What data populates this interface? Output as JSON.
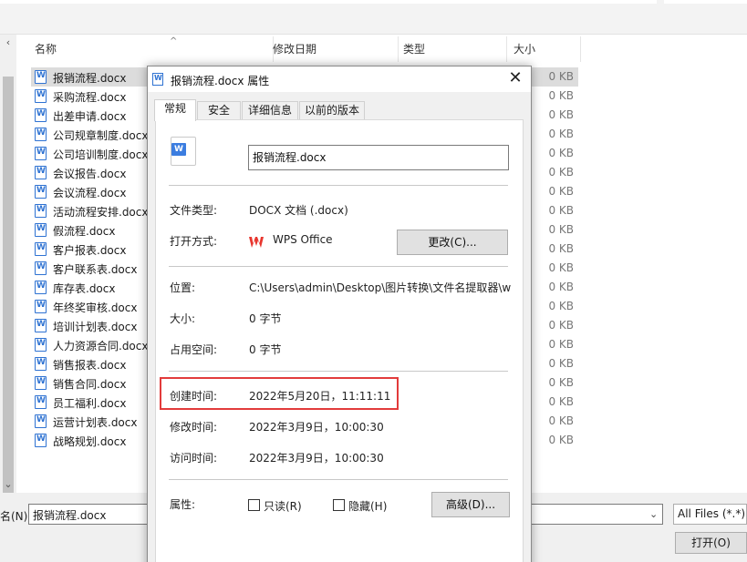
{
  "columns": {
    "name": "名称",
    "modified": "修改日期",
    "type": "类型",
    "size": "大小"
  },
  "files": [
    {
      "name": "报销流程.docx",
      "size": "0 KB"
    },
    {
      "name": "采购流程.docx",
      "size": "0 KB"
    },
    {
      "name": "出差申请.docx",
      "size": "0 KB"
    },
    {
      "name": "公司规章制度.docx",
      "size": "0 KB"
    },
    {
      "name": "公司培训制度.docx",
      "size": "0 KB"
    },
    {
      "name": "会议报告.docx",
      "size": "0 KB"
    },
    {
      "name": "会议流程.docx",
      "size": "0 KB"
    },
    {
      "name": "活动流程安排.docx",
      "size": "0 KB"
    },
    {
      "name": "假流程.docx",
      "size": "0 KB"
    },
    {
      "name": "客户报表.docx",
      "size": "0 KB"
    },
    {
      "name": "客户联系表.docx",
      "size": "0 KB"
    },
    {
      "name": "库存表.docx",
      "size": "0 KB"
    },
    {
      "name": "年终奖审核.docx",
      "size": "0 KB"
    },
    {
      "name": "培训计划表.docx",
      "size": "0 KB"
    },
    {
      "name": "人力资源合同.docx",
      "size": "0 KB"
    },
    {
      "name": "销售报表.docx",
      "size": "0 KB"
    },
    {
      "name": "销售合同.docx",
      "size": "0 KB"
    },
    {
      "name": "员工福利.docx",
      "size": "0 KB"
    },
    {
      "name": "运营计划表.docx",
      "size": "0 KB"
    },
    {
      "name": "战略规划.docx",
      "size": "0 KB"
    }
  ],
  "bottom": {
    "filename_label": "名(N):",
    "filename_value": "报销流程.docx",
    "filetype": "All Files (*.*)",
    "open_label": "打开(O)"
  },
  "dialog": {
    "title": "报销流程.docx 属性",
    "close": "✕",
    "tabs": [
      "常规",
      "安全",
      "详细信息",
      "以前的版本"
    ],
    "file_name": "报销流程.docx",
    "file_type_label": "文件类型:",
    "file_type_value": "DOCX 文档 (.docx)",
    "open_with_label": "打开方式:",
    "open_with_value": "WPS Office",
    "change_button": "更改(C)...",
    "location_label": "位置:",
    "location_value": "C:\\Users\\admin\\Desktop\\图片转换\\文件名提取器\\w",
    "size_label": "大小:",
    "size_value": "0 字节",
    "disk_size_label": "占用空间:",
    "disk_size_value": "0 字节",
    "created_label": "创建时间:",
    "created_value": "2022年5月20日，11:11:11",
    "modified_label": "修改时间:",
    "modified_value": "2022年3月9日，10:00:30",
    "accessed_label": "访问时间:",
    "accessed_value": "2022年3月9日，10:00:30",
    "attributes_label": "属性:",
    "readonly_label": "只读(R)",
    "hidden_label": "隐藏(H)",
    "advanced_button": "高级(D)...",
    "highlight_color": "#e23b3b"
  }
}
